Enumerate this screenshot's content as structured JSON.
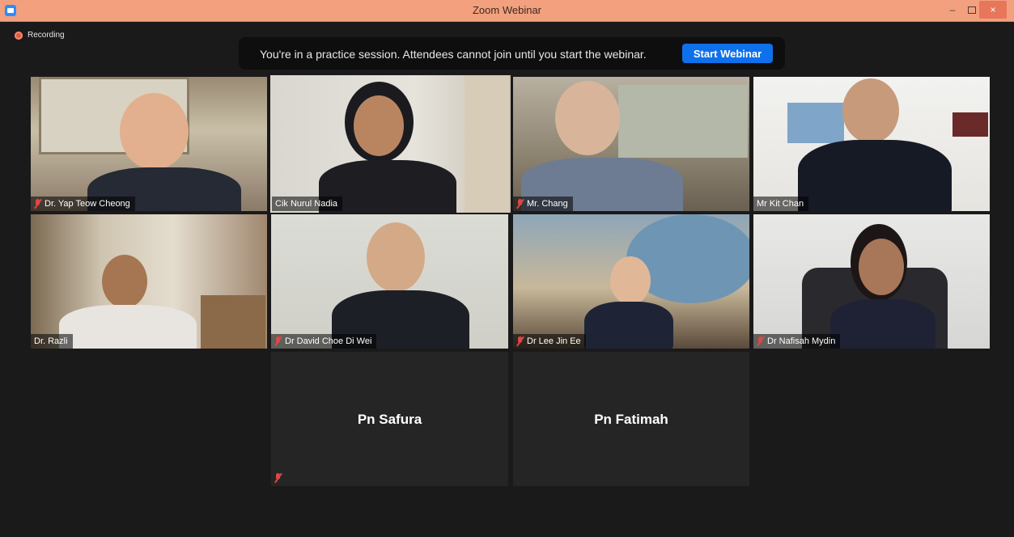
{
  "window": {
    "title": "Zoom Webinar",
    "controls": {
      "minimize": "–",
      "close": "×"
    }
  },
  "recording": {
    "label": "Recording"
  },
  "banner": {
    "message": "You're in a practice session. Attendees cannot join until you start the webinar.",
    "button": "Start Webinar"
  },
  "tiles": [
    {
      "name": "Dr. Yap Teow Cheong",
      "muted": true,
      "active": false
    },
    {
      "name": "Cik Nurul Nadia",
      "muted": false,
      "active": true
    },
    {
      "name": "Mr. Chang",
      "muted": true,
      "active": false
    },
    {
      "name": "Mr Kit Chan",
      "muted": false,
      "active": false
    },
    {
      "name": "Dr. Razli",
      "muted": false,
      "active": false
    },
    {
      "name": "Dr David Choe Di Wei",
      "muted": true,
      "active": false
    },
    {
      "name": "Dr Lee Jin Ee",
      "muted": true,
      "active": false
    },
    {
      "name": "Dr Nafisah Mydin",
      "muted": true,
      "active": false
    },
    {
      "name": "Pn Safura",
      "muted": true,
      "video": false
    },
    {
      "name": "Pn Fatimah",
      "muted": false,
      "video": false
    }
  ],
  "colors": {
    "titlebar": "#f3a07f",
    "accent": "#0e71eb",
    "active_speaker": "#d9e64a",
    "muted_mic": "#e04646"
  }
}
